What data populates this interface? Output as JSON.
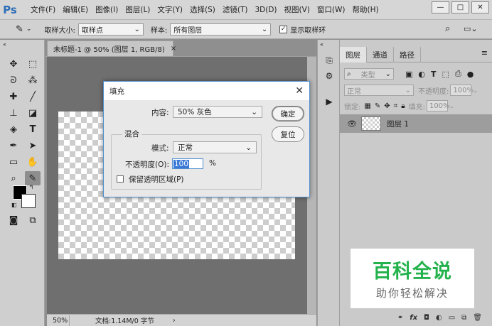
{
  "app": {
    "logo": "Ps",
    "menu": [
      "文件(F)",
      "编辑(E)",
      "图像(I)",
      "图层(L)",
      "文字(Y)",
      "选择(S)",
      "滤镜(T)",
      "3D(D)",
      "视图(V)",
      "窗口(W)",
      "帮助(H)"
    ],
    "window_controls": {
      "minimize": "—",
      "maximize": "□",
      "close": "✕"
    }
  },
  "options_bar": {
    "sample_size_label": "取样大小:",
    "sample_size_value": "取样点",
    "sample_label": "样本:",
    "sample_value": "所有图层",
    "show_ring_label": "显示取样环",
    "show_ring_checked": true
  },
  "document": {
    "tab_title": "未标题-1 @ 50% (图层 1, RGB/8)",
    "tab_close": "×",
    "zoom": "50%",
    "doc_info": "文档:1.14M/0 字节"
  },
  "layers_panel": {
    "tabs": [
      "图层",
      "通道",
      "路径"
    ],
    "active_tab": "图层",
    "filter_kind": "类型",
    "blend_mode": "正常",
    "opacity_label": "不透明度:",
    "opacity_value": "100%",
    "lock_label": "锁定:",
    "fill_label": "填充:",
    "fill_value": "100%",
    "layers": [
      {
        "name": "图层 1",
        "visible": true
      }
    ]
  },
  "fill_dialog": {
    "title": "填充",
    "contents_label": "内容:",
    "contents_value": "50% 灰色",
    "ok_label": "确定",
    "reset_label": "复位",
    "blending_legend": "混合",
    "mode_label": "模式:",
    "mode_value": "正常",
    "opacity_label": "不透明度(O):",
    "opacity_value": "100",
    "opacity_unit": "%",
    "preserve_transparency_label": "保留透明区域(P)",
    "preserve_transparency_checked": false
  },
  "watermark": {
    "title": "百科全说",
    "subtitle": "助你轻松解决"
  },
  "colors": {
    "foreground": "#000000",
    "background": "#ffffff",
    "accent": "#3a78d6",
    "watermark_green": "#23b24b"
  }
}
